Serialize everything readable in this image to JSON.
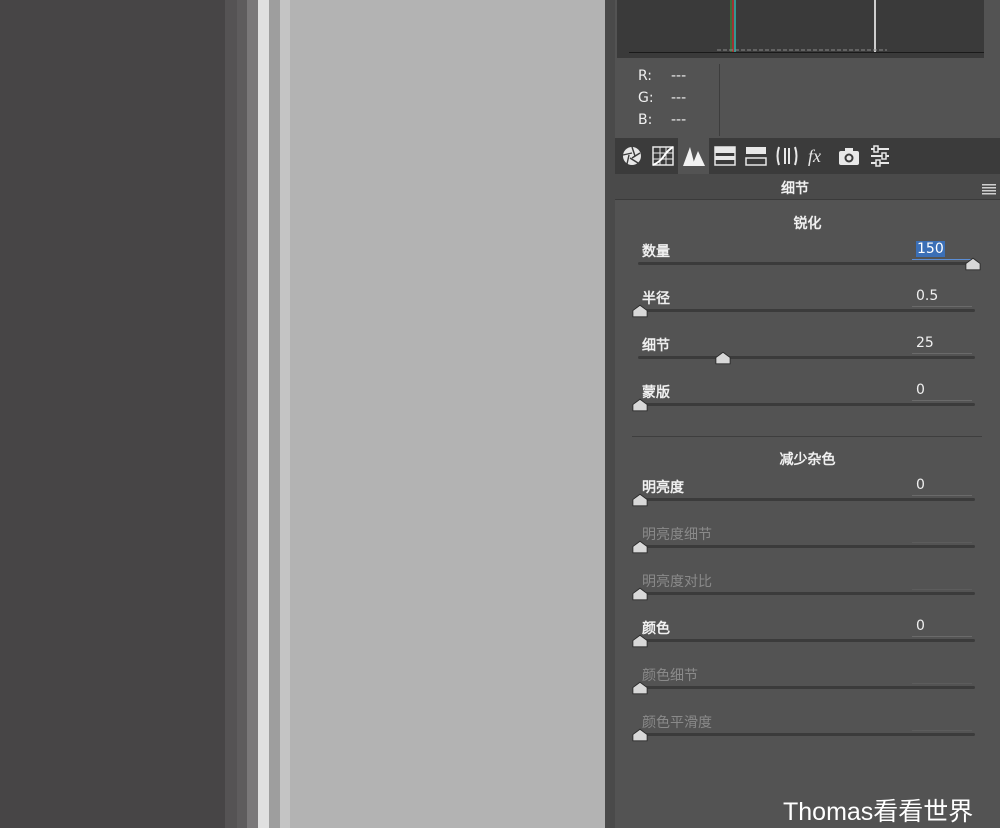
{
  "colors": {
    "accent": "#3b6fb6",
    "panel": "#535353",
    "preview": "#b3b3b3"
  },
  "histogram": {
    "readouts": [
      {
        "label": "R:",
        "value": "---"
      },
      {
        "label": "G:",
        "value": "---"
      },
      {
        "label": "B:",
        "value": "---"
      }
    ]
  },
  "tabs": [
    {
      "icon": "aperture-icon"
    },
    {
      "icon": "tone-curve-icon"
    },
    {
      "icon": "detail-icon",
      "active": true
    },
    {
      "icon": "hsl-icon"
    },
    {
      "icon": "split-toning-icon"
    },
    {
      "icon": "lens-corrections-icon"
    },
    {
      "icon": "fx-icon"
    },
    {
      "icon": "camera-calibration-icon"
    },
    {
      "icon": "presets-icon"
    }
  ],
  "panel": {
    "title": "细节"
  },
  "sharpening": {
    "title": "锐化",
    "sliders": [
      {
        "label": "数量",
        "value": "150",
        "level": 1.0,
        "selected": true
      },
      {
        "label": "半径",
        "value": "0.5",
        "level": 0.0
      },
      {
        "label": "细节",
        "value": "25",
        "level": 0.25
      },
      {
        "label": "蒙版",
        "value": "0",
        "level": 0.0
      }
    ]
  },
  "noise_reduction": {
    "title": "减少杂色",
    "sliders": [
      {
        "label": "明亮度",
        "value": "0",
        "level": 0.0
      },
      {
        "label": "明亮度细节",
        "value": "",
        "level": 0.0,
        "disabled": true
      },
      {
        "label": "明亮度对比",
        "value": "",
        "level": 0.0,
        "disabled": true
      },
      {
        "label": "颜色",
        "value": "0",
        "level": 0.0
      },
      {
        "label": "颜色细节",
        "value": "",
        "level": 0.0,
        "disabled": true
      },
      {
        "label": "颜色平滑度",
        "value": "",
        "level": 0.0,
        "disabled": true
      }
    ]
  },
  "watermark": "Thomas看看世界"
}
